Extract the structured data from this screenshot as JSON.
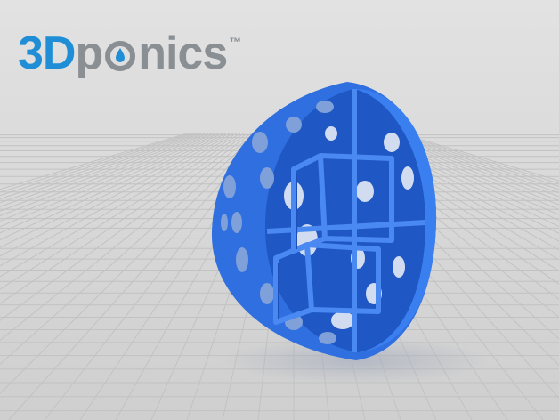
{
  "logo": {
    "part_3d": "3D",
    "part_p": "p",
    "part_nics": "nics",
    "trademark": "™"
  },
  "colors": {
    "brand_blue": "#1f8ed6",
    "brand_gray": "#8a8f94",
    "model_blue": "#2f6fe0",
    "grid_line": "#c4c4c4",
    "floor": "#d6d6d6"
  },
  "object": {
    "icon": "hydroponic-net-pot-sphere-icon"
  }
}
